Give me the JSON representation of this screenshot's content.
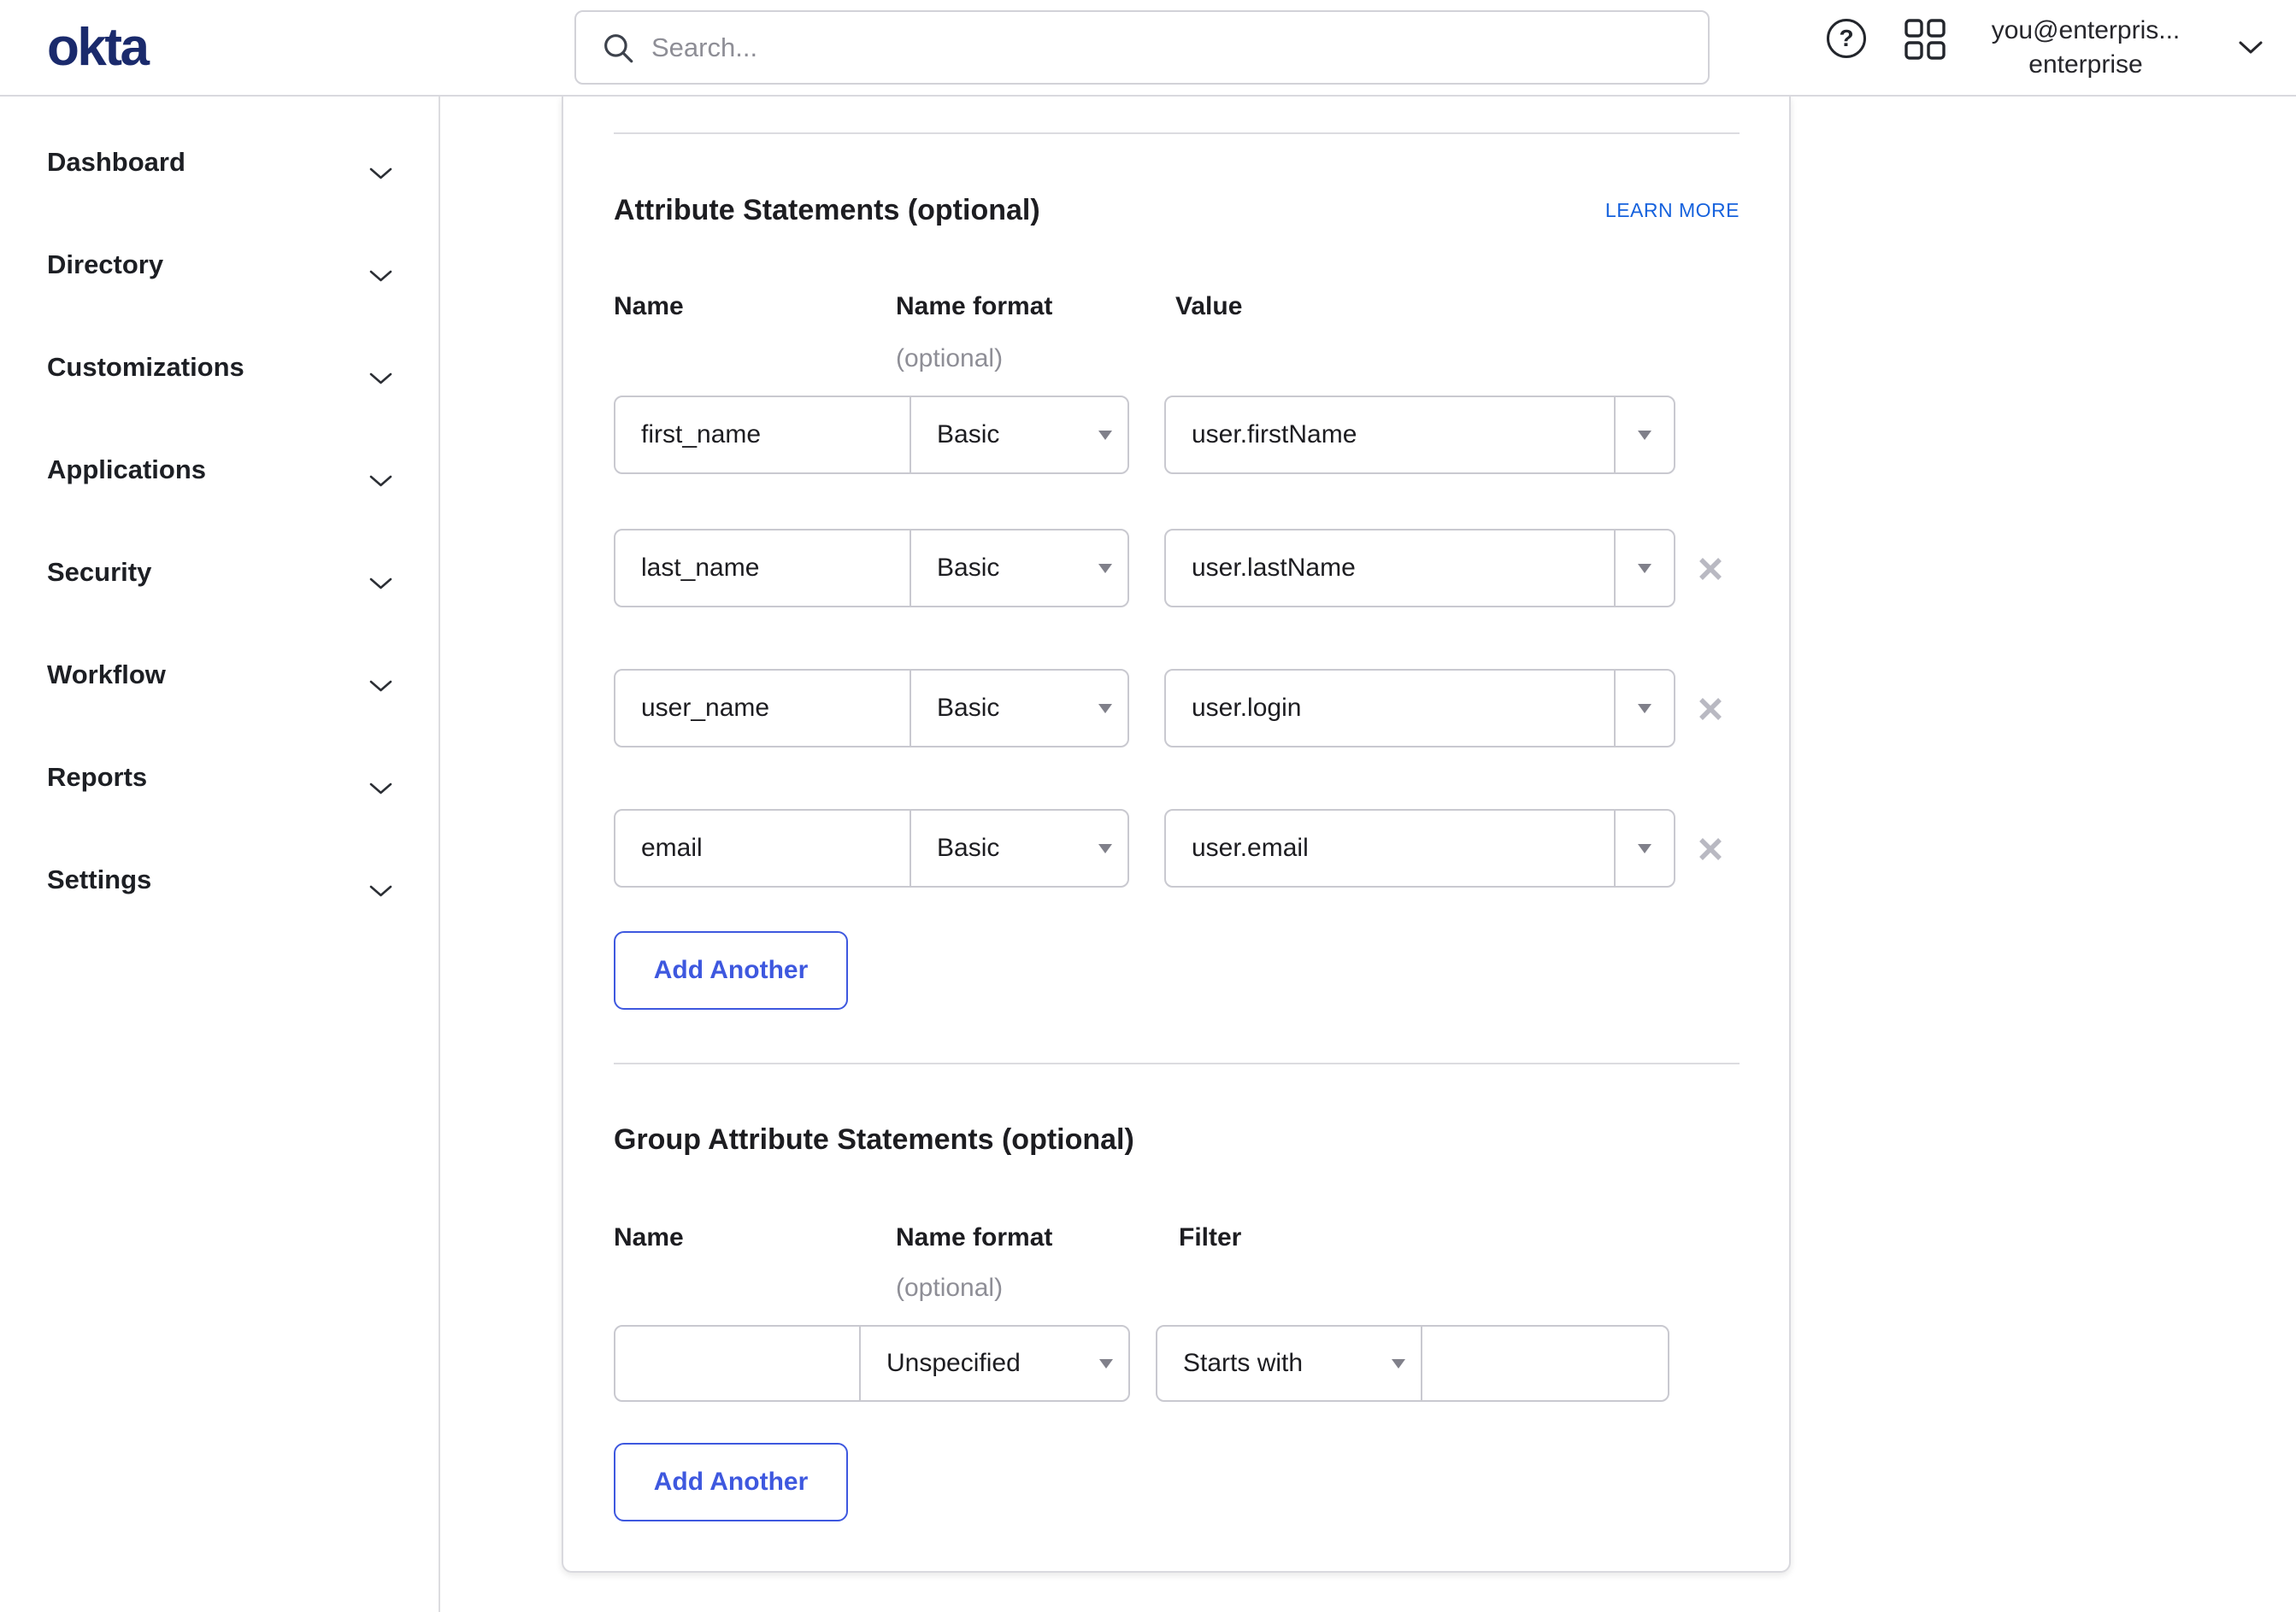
{
  "topbar": {
    "logo": "okta",
    "search_placeholder": "Search...",
    "account": {
      "line1": "you@enterpris...",
      "line2": "enterprise"
    }
  },
  "sidebar": {
    "items": [
      {
        "label": "Dashboard"
      },
      {
        "label": "Directory"
      },
      {
        "label": "Customizations"
      },
      {
        "label": "Applications"
      },
      {
        "label": "Security"
      },
      {
        "label": "Workflow"
      },
      {
        "label": "Reports"
      },
      {
        "label": "Settings"
      }
    ]
  },
  "attribute_section": {
    "title": "Attribute Statements (optional)",
    "learn_more_label": "LEARN MORE",
    "columns": {
      "name": "Name",
      "format": "Name format",
      "format_note": "(optional)",
      "value": "Value"
    },
    "rows": [
      {
        "name": "first_name",
        "format": "Basic",
        "value": "user.firstName",
        "removable": false
      },
      {
        "name": "last_name",
        "format": "Basic",
        "value": "user.lastName",
        "removable": true
      },
      {
        "name": "user_name",
        "format": "Basic",
        "value": "user.login",
        "removable": true
      },
      {
        "name": "email",
        "format": "Basic",
        "value": "user.email",
        "removable": true
      }
    ],
    "add_button_label": "Add Another"
  },
  "group_section": {
    "title": "Group Attribute Statements (optional)",
    "columns": {
      "name": "Name",
      "format": "Name format",
      "format_note": "(optional)",
      "filter": "Filter"
    },
    "row": {
      "name": "",
      "format": "Unspecified",
      "filter_op": "Starts with",
      "filter_value": ""
    },
    "add_button_label": "Add Another"
  },
  "colors": {
    "accent_blue": "#3e58df",
    "link_blue": "#1662dd",
    "logo_navy": "#1a2a6c",
    "border_gray": "#d9d9de",
    "input_border": "#c9c9d0",
    "text_dark": "#1d1d21",
    "text_gray": "#8e8e96",
    "remove_icon_gray": "#b9b9c2"
  }
}
